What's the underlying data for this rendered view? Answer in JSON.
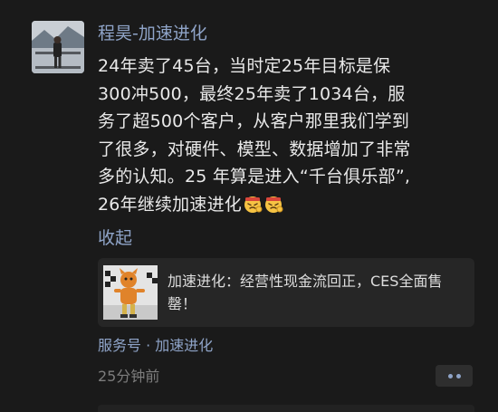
{
  "post": {
    "author": "程昊-加速进化",
    "content_lines": [
      "24年卖了45台，当时定25年目标是保",
      "300冲500，最终25年卖了1034台，服",
      "务了超500个客户，从客户那里我们学到",
      "了很多，对硬件、模型、数据增加了非常",
      "多的认知。25 年算是进入“千台俱乐部”,",
      "26年继续加速进化"
    ],
    "emoji_icon": "strong-face-emoji-icon",
    "collapse_label": "收起",
    "shared_card": {
      "text": "加速进化：经营性现金流回正，CES全面售罄！"
    },
    "source_label": "服务号 · 加速进化",
    "time_label": "25分钟前"
  },
  "colors": {
    "background": "#1a1a1a",
    "link": "#8fa4c8",
    "text": "#e9e9e9",
    "muted": "#7d7d7d",
    "card": "#262626"
  }
}
